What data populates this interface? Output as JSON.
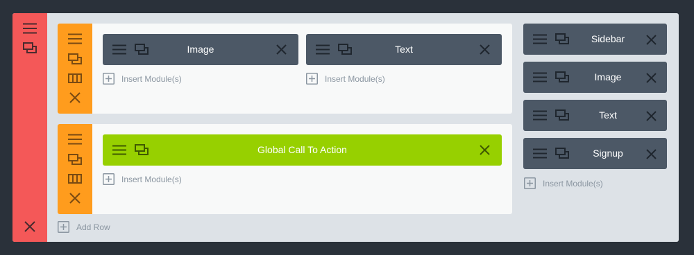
{
  "colors": {
    "background": "#2a313a",
    "section_bg": "#dde2e7",
    "section_handle": "#f45858",
    "row_handle": "#ff9c1d",
    "row_bg": "#f8f9f9",
    "module_bg": "#4c5866",
    "global_module_bg": "#97d000",
    "insert_text": "#8b96a1"
  },
  "section": {
    "handle_icons": [
      "hamburger-icon",
      "duplicate-icon",
      "close-icon"
    ],
    "add_row_label": "Add Row"
  },
  "rows": [
    {
      "handle_icons": [
        "hamburger-icon",
        "duplicate-icon",
        "columns-icon",
        "close-icon"
      ],
      "columns": [
        {
          "modules": [
            {
              "title": "Image",
              "global": false
            }
          ],
          "insert_label": "Insert Module(s)"
        },
        {
          "modules": [
            {
              "title": "Text",
              "global": false
            }
          ],
          "insert_label": "Insert Module(s)"
        }
      ]
    },
    {
      "handle_icons": [
        "hamburger-icon",
        "duplicate-icon",
        "columns-icon",
        "close-icon"
      ],
      "columns": [
        {
          "modules": [
            {
              "title": "Global Call To Action",
              "global": true
            }
          ],
          "insert_label": "Insert Module(s)"
        }
      ]
    }
  ],
  "sidebar": {
    "modules": [
      {
        "title": "Sidebar"
      },
      {
        "title": "Image"
      },
      {
        "title": "Text"
      },
      {
        "title": "Signup"
      }
    ],
    "insert_label": "Insert Module(s)"
  }
}
